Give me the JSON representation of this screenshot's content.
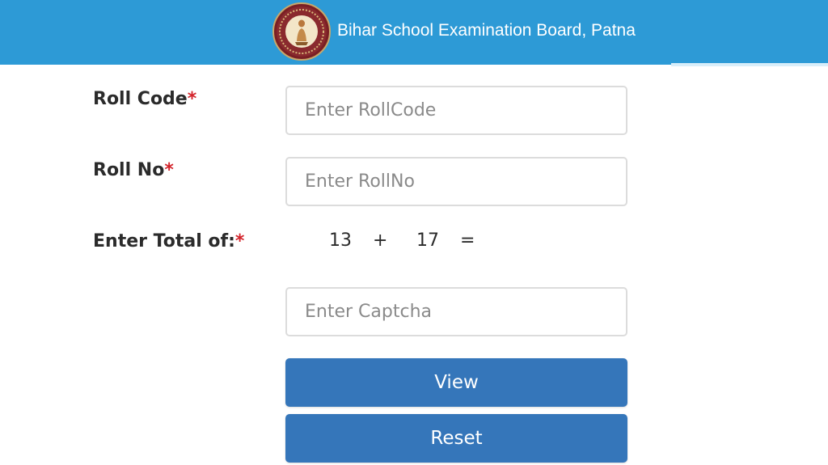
{
  "header": {
    "title": "Bihar School Examination Board, Patna",
    "logo_icon": "bseb-emblem-icon"
  },
  "form": {
    "roll_code": {
      "label": "Roll Code",
      "required_mark": "*",
      "value": "",
      "placeholder": "Enter RollCode"
    },
    "roll_no": {
      "label": "Roll No",
      "required_mark": "*",
      "value": "",
      "placeholder": "Enter RollNo"
    },
    "captcha": {
      "label": "Enter Total of:",
      "required_mark": "*",
      "operand1": "13",
      "operator": "+",
      "operand2": "17",
      "equals": "=",
      "value": "",
      "placeholder": "Enter Captcha"
    },
    "view_button": "View",
    "reset_button": "Reset"
  },
  "colors": {
    "header_bg": "#2d9ad6",
    "button_bg": "#3576ba",
    "required": "#d3232a"
  }
}
